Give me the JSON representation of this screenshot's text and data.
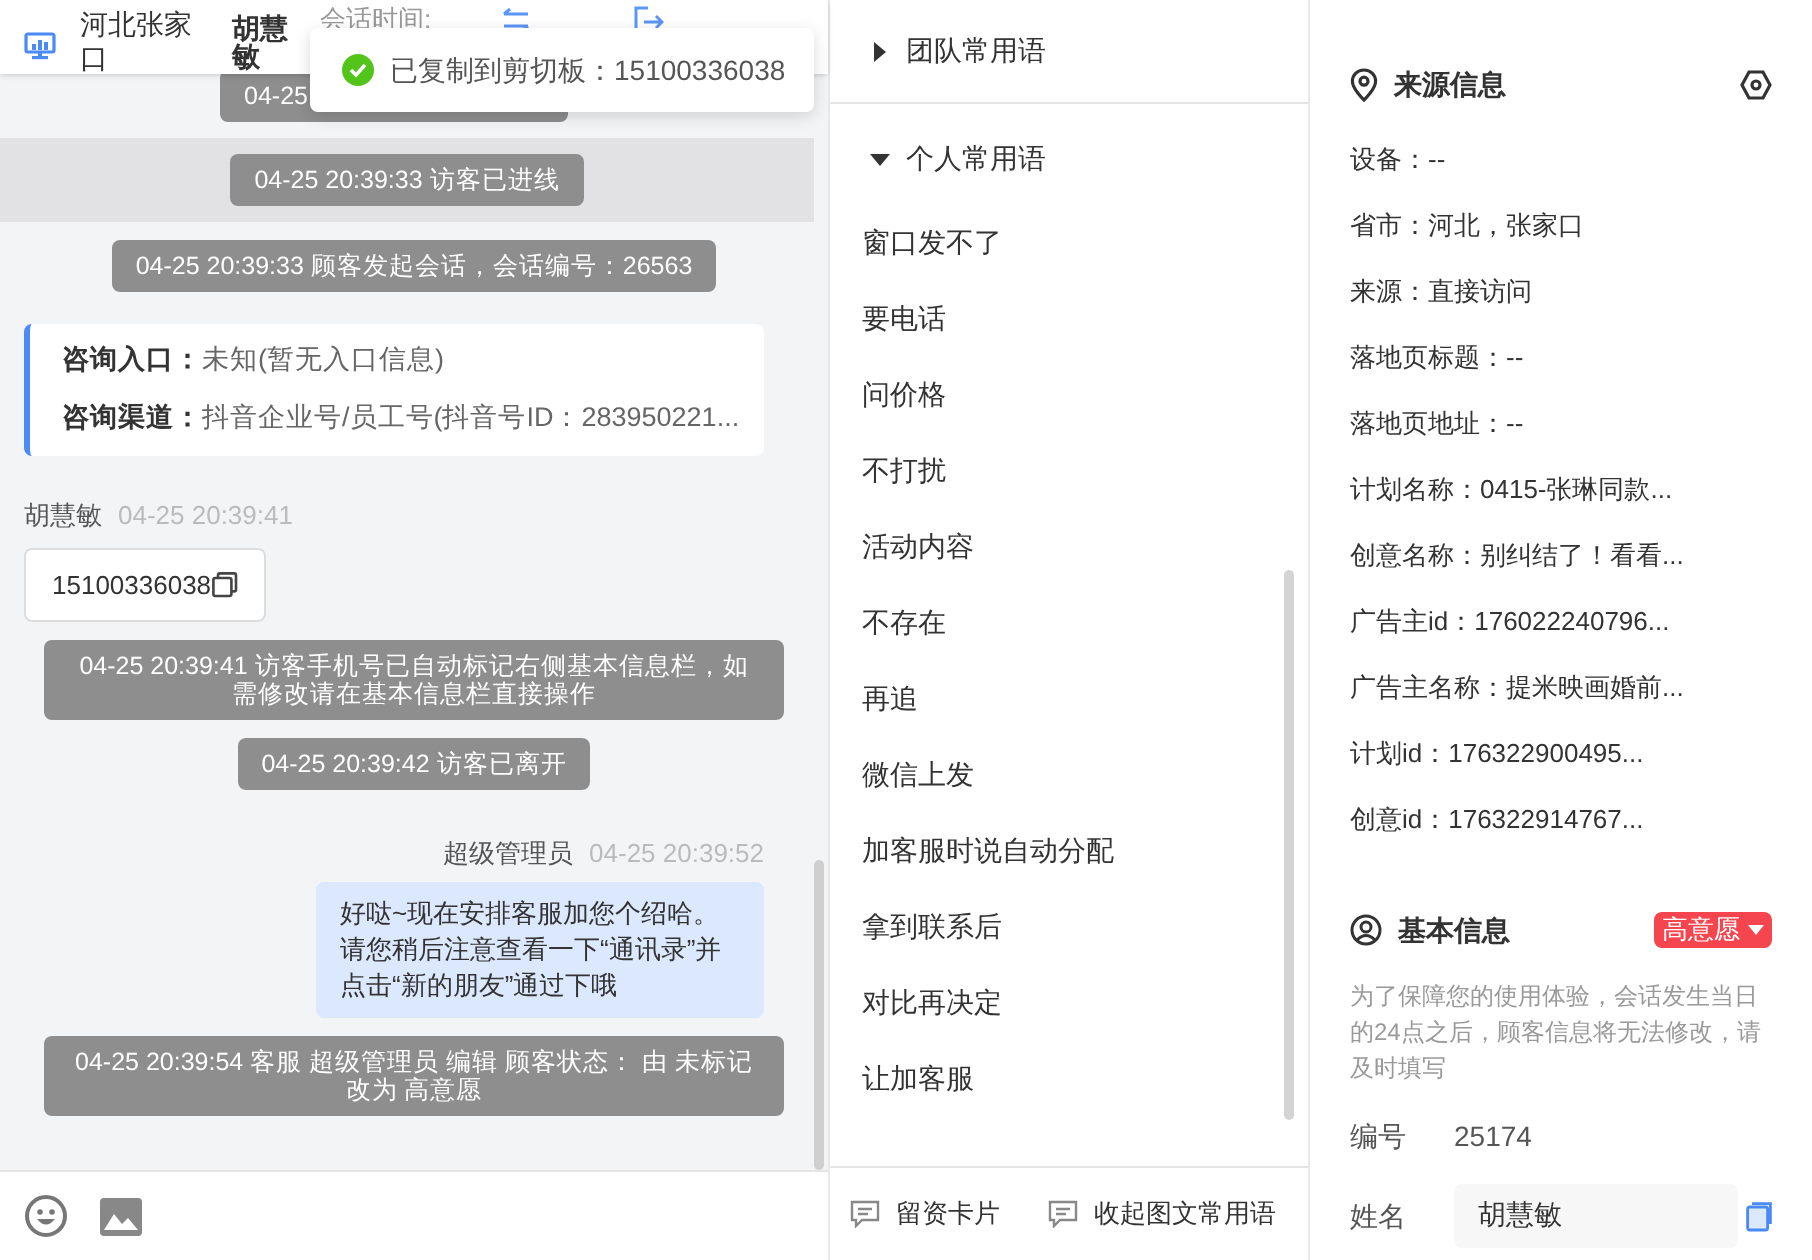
{
  "header": {
    "location": "河北张家口",
    "agent": "胡慧敏",
    "session_time_label": "会话时间:"
  },
  "toast": {
    "text": "已复制到剪切板：15100336038"
  },
  "chat": {
    "messages": [
      {
        "kind": "system_cut",
        "text": "04-25"
      },
      {
        "kind": "system",
        "text": "04-25 20:39:33 访客已进线",
        "highlighted": true
      },
      {
        "kind": "system",
        "text": "04-25 20:39:33 顾客发起会话，会话编号：26563",
        "highlighted": false
      },
      {
        "kind": "entry_card",
        "rows": [
          {
            "label": "咨询入口：",
            "value": "未知(暂无入口信息)"
          },
          {
            "label": "咨询渠道：",
            "value": "抖音企业号/员工号(抖音号ID：283950221..."
          }
        ]
      },
      {
        "kind": "visitor",
        "sender": "胡慧敏",
        "time": "04-25 20:39:41",
        "text": "15100336038"
      },
      {
        "kind": "system",
        "text": "04-25 20:39:41 访客手机号已自动标记右侧基本信息栏，如需修改请在基本信息栏直接操作",
        "highlighted": false
      },
      {
        "kind": "system",
        "text": "04-25 20:39:42 访客已离开",
        "highlighted": false
      },
      {
        "kind": "agent",
        "sender": "超级管理员",
        "time": "04-25 20:39:52",
        "text": "好哒~现在安排客服加您个绍哈。请您稍后注意查看一下“通讯录”并点击“新的朋友”通过下哦"
      },
      {
        "kind": "system",
        "text": "04-25 20:39:54 客服 超级管理员 编辑 顾客状态： 由 未标记改为 高意愿",
        "highlighted": false
      }
    ]
  },
  "phrases": {
    "groups": [
      {
        "title": "团队常用语",
        "expanded": false
      },
      {
        "title": "个人常用语",
        "expanded": true,
        "items": [
          "窗口发不了",
          "要电话",
          "问价格",
          "不打扰",
          "活动内容",
          "不存在",
          "再追",
          "微信上发",
          "加客服时说自动分配",
          "拿到联系后",
          "对比再决定",
          "让加客服"
        ]
      }
    ],
    "actions": [
      "留资卡片",
      "收起图文常用语"
    ]
  },
  "source_info": {
    "title": "来源信息",
    "fields": [
      "设备：--",
      "省市：河北，张家口",
      "来源：直接访问",
      "落地页标题：--",
      "落地页地址：--",
      "计划名称：0415-张琳同款...",
      "创意名称：别纠结了！看看...",
      "广告主id：176022240796...",
      "广告主名称：提米映画婚前...",
      "计划id：176322900495...",
      "创意id：176322914767..."
    ]
  },
  "basic_info": {
    "title": "基本信息",
    "intent_badge": "高意愿",
    "notice": "为了保障您的使用体验，会话发生当日的24点之后，顾客信息将无法修改，请及时填写",
    "fields": [
      {
        "kind": "text",
        "label": "编号",
        "value": "25174"
      },
      {
        "kind": "input",
        "label": "姓名",
        "value": "胡慧敏"
      }
    ]
  }
}
